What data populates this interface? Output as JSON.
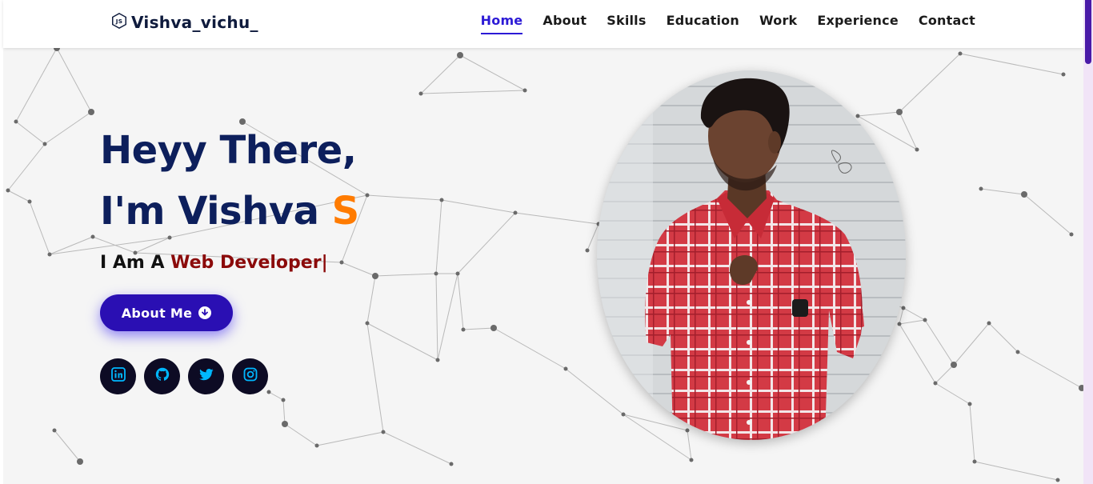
{
  "brand": {
    "logo_icon": "nodejs-hexagon-icon",
    "name": "Vishva_vichu_"
  },
  "nav": {
    "items": [
      "Home",
      "About",
      "Skills",
      "Education",
      "Work",
      "Experience",
      "Contact"
    ],
    "active": "Home"
  },
  "hero": {
    "line1": "Heyy There,",
    "line2_prefix": "I'm Vishva ",
    "line2_accent": "S",
    "role_prefix": "I Am A ",
    "role_typed": "Web Developer",
    "role_cursor": "|",
    "button_label": "About Me",
    "button_icon": "arrow-circle-down-icon"
  },
  "socials": [
    "linkedin-icon",
    "github-icon",
    "twitter-icon",
    "instagram-icon"
  ],
  "colors": {
    "accent": "#ff7b00",
    "primary": "#2a0fb3",
    "heading": "#0d1f5c",
    "typed": "#8b0a0a",
    "social_icon": "#00b7ff"
  }
}
